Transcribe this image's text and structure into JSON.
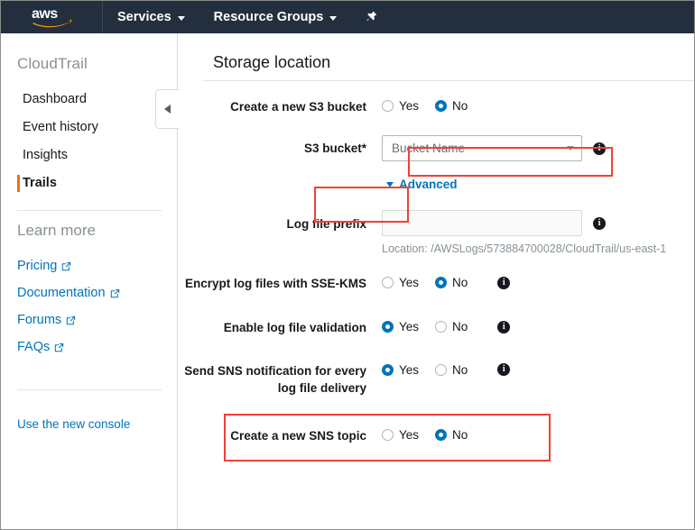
{
  "topnav": {
    "logo_alt": "aws",
    "items": [
      {
        "label": "Services",
        "has_caret": true
      },
      {
        "label": "Resource Groups",
        "has_caret": true
      }
    ],
    "pin_icon": "pin-icon",
    "background": "#232f3e"
  },
  "sidebar": {
    "service_title": "CloudTrail",
    "nav_items": [
      {
        "label": "Dashboard",
        "selected": false
      },
      {
        "label": "Event history",
        "selected": false
      },
      {
        "label": "Insights",
        "selected": false
      },
      {
        "label": "Trails",
        "selected": true
      }
    ],
    "learn_more_title": "Learn more",
    "learn_more_links": [
      {
        "label": "Pricing"
      },
      {
        "label": "Documentation"
      },
      {
        "label": "Forums"
      },
      {
        "label": "FAQs"
      }
    ],
    "new_console_label": "Use the new console",
    "selected_accent": "#ec7211",
    "link_color": "#0073bb"
  },
  "collapse_tab": {
    "icon": "triangle-left-icon"
  },
  "main": {
    "section_title": "Storage location",
    "rows": [
      {
        "id": "create-new-s3-bucket",
        "label": "Create a new S3 bucket",
        "type": "radio",
        "options": [
          "Yes",
          "No"
        ],
        "selected": "No",
        "info": false
      },
      {
        "id": "s3-bucket",
        "label": "S3 bucket*",
        "type": "select",
        "value": "Bucket Name",
        "info": true,
        "highlighted": true
      },
      {
        "id": "advanced",
        "label": "",
        "type": "link",
        "link_label": "Advanced",
        "expanded": true,
        "highlighted": true
      },
      {
        "id": "log-file-prefix",
        "label": "Log file prefix",
        "type": "text",
        "value": "",
        "placeholder": "",
        "hint": "Location: /AWSLogs/573884700028/CloudTrail/us-east-1",
        "info": true
      },
      {
        "id": "encrypt-log-files-sse-kms",
        "label": "Encrypt log files with SSE-KMS",
        "type": "radio",
        "options": [
          "Yes",
          "No"
        ],
        "selected": "No",
        "info": true
      },
      {
        "id": "enable-log-file-validation",
        "label": "Enable log file validation",
        "type": "radio",
        "options": [
          "Yes",
          "No"
        ],
        "selected": "Yes",
        "info": true
      },
      {
        "id": "send-sns-notification",
        "label": "Send SNS notification for every log file delivery",
        "type": "radio",
        "options": [
          "Yes",
          "No"
        ],
        "selected": "Yes",
        "info": true,
        "highlighted": true
      },
      {
        "id": "create-new-sns-topic",
        "label": "Create a new SNS topic",
        "type": "radio",
        "options": [
          "Yes",
          "No"
        ],
        "selected": "No",
        "info": false
      }
    ],
    "highlight_color": "#ef4136",
    "radio_selected_color": "#0073bb"
  }
}
